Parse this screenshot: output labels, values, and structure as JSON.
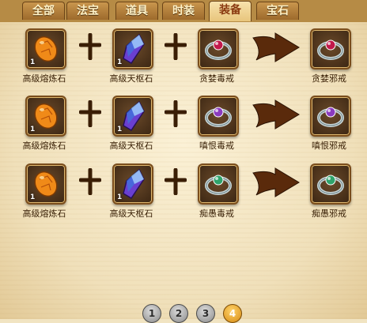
{
  "tabs": [
    {
      "label": "全部",
      "active": false
    },
    {
      "label": "法宝",
      "active": false
    },
    {
      "label": "道具",
      "active": false
    },
    {
      "label": "时装",
      "active": false
    },
    {
      "label": "装备",
      "active": true
    },
    {
      "label": "宝石",
      "active": false
    }
  ],
  "recipes": [
    {
      "ingredients": [
        {
          "name": "高级熔炼石",
          "count": "1",
          "icon": "orange-egg-stone-icon"
        },
        {
          "name": "高级天枢石",
          "count": "1",
          "icon": "purple-crystal-icon"
        },
        {
          "name": "贪婪毒戒",
          "count": "",
          "icon": "ring-red-gem-icon"
        }
      ],
      "result": {
        "name": "贪婪邪戒",
        "icon": "ring-red-gem-icon"
      }
    },
    {
      "ingredients": [
        {
          "name": "高级熔炼石",
          "count": "1",
          "icon": "orange-egg-stone-icon"
        },
        {
          "name": "高级天枢石",
          "count": "1",
          "icon": "purple-crystal-icon"
        },
        {
          "name": "嗔恨毒戒",
          "count": "",
          "icon": "ring-purple-gem-icon"
        }
      ],
      "result": {
        "name": "嗔恨邪戒",
        "icon": "ring-purple-gem-icon"
      }
    },
    {
      "ingredients": [
        {
          "name": "高级熔炼石",
          "count": "1",
          "icon": "orange-egg-stone-icon"
        },
        {
          "name": "高级天枢石",
          "count": "1",
          "icon": "purple-crystal-icon"
        },
        {
          "name": "痴愚毒戒",
          "count": "",
          "icon": "ring-green-gem-icon"
        }
      ],
      "result": {
        "name": "痴愚邪戒",
        "icon": "ring-green-gem-icon"
      }
    }
  ],
  "pagination": {
    "pages": [
      "1",
      "2",
      "3",
      "4"
    ],
    "active": "4"
  },
  "colors": {
    "ring_red": "#c2184b",
    "ring_purple": "#8b3bbf",
    "ring_green": "#2fa36b",
    "stone_orange": "#f08a18",
    "crystal_purple": "#6a3fd0"
  }
}
